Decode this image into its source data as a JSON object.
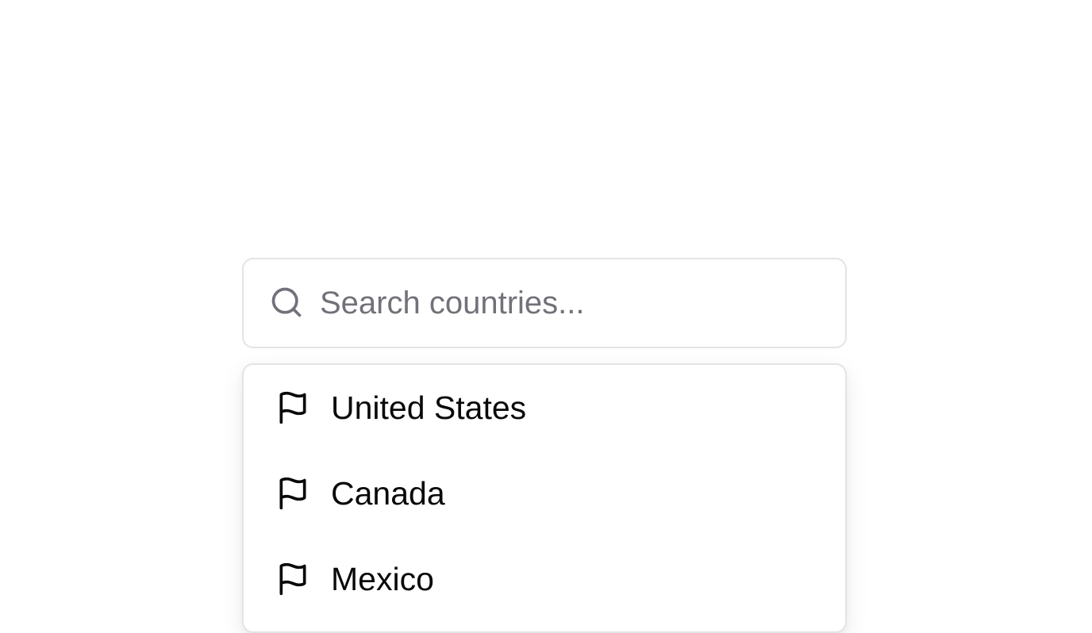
{
  "search": {
    "placeholder": "Search countries...",
    "value": "",
    "icon": "search-icon"
  },
  "dropdown": {
    "options": [
      {
        "label": "United States",
        "icon": "flag-icon"
      },
      {
        "label": "Canada",
        "icon": "flag-icon"
      },
      {
        "label": "Mexico",
        "icon": "flag-icon"
      }
    ]
  },
  "colors": {
    "border": "#e4e4e7",
    "placeholder": "#71717a",
    "text": "#09090b"
  }
}
